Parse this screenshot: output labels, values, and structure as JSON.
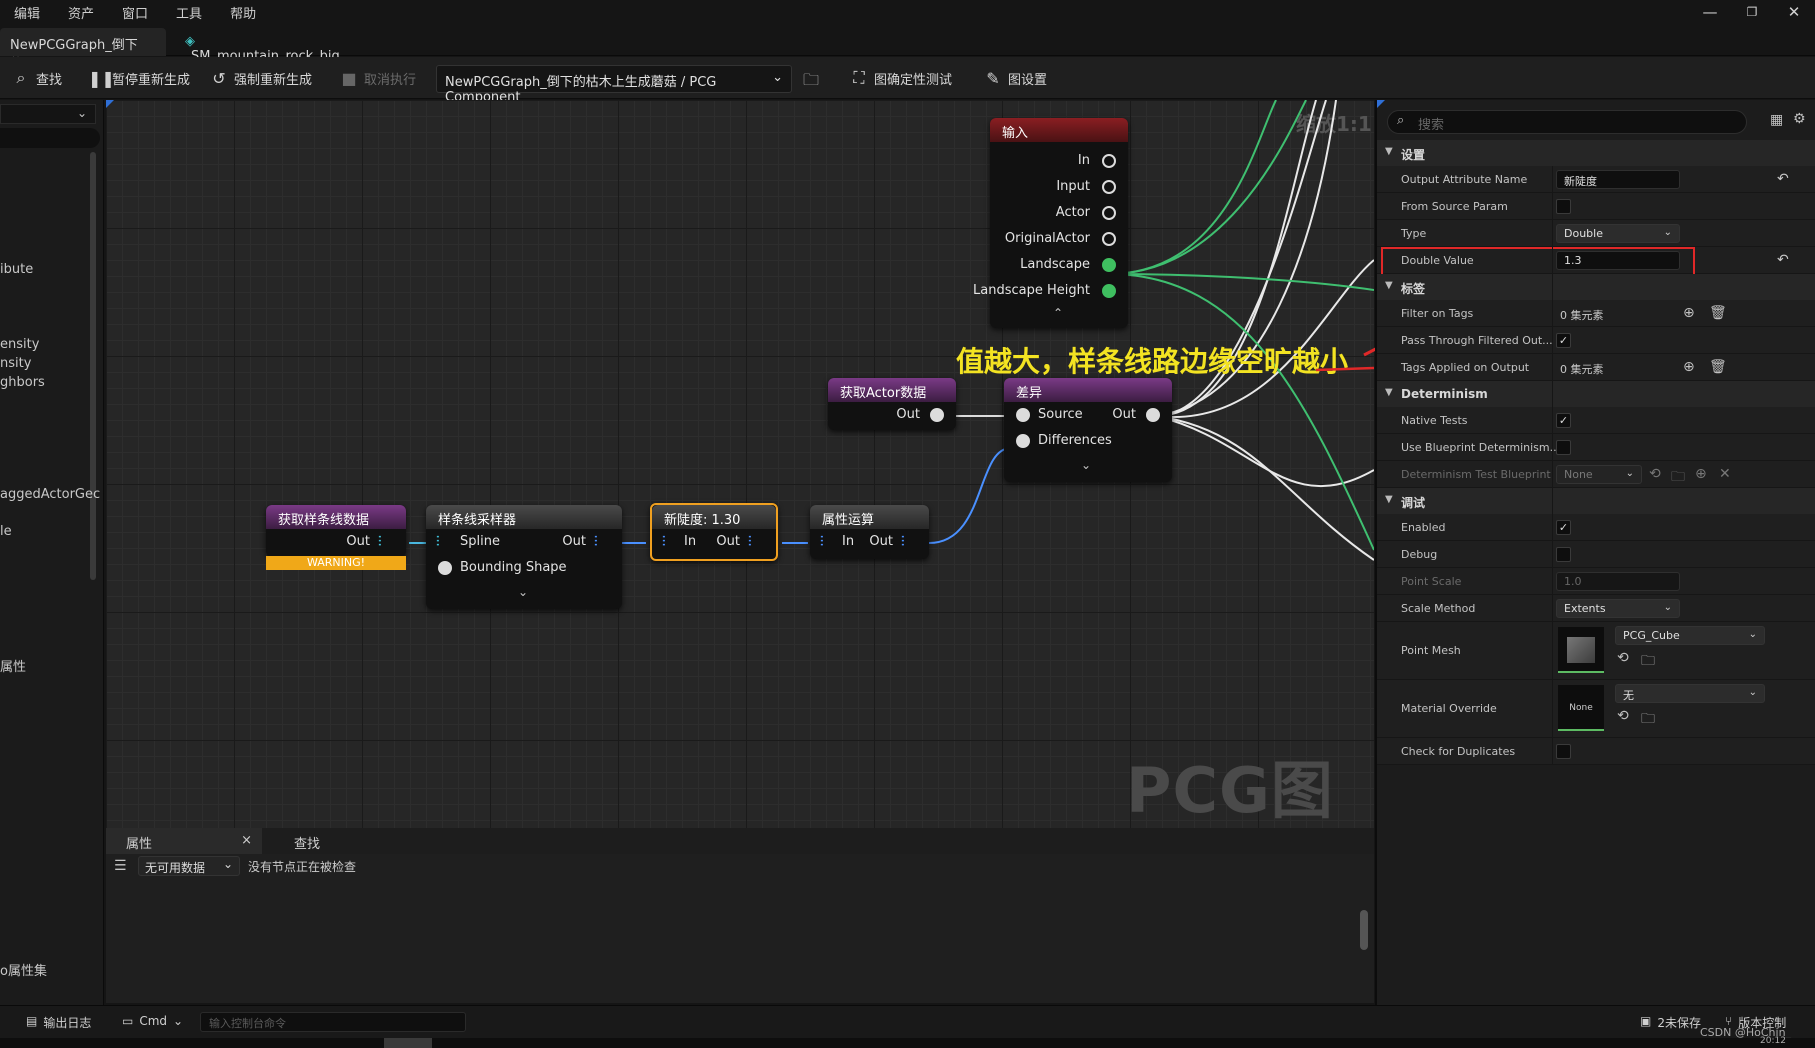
{
  "menu": {
    "items": [
      "编辑",
      "资产",
      "窗口",
      "工具",
      "帮助"
    ]
  },
  "window_controls": {
    "minimize": "—",
    "restore": "❐",
    "close": "✕"
  },
  "tabs": {
    "active": "NewPCGGraph_倒下的... • ×",
    "second": "SM_mountain_rock_big_..."
  },
  "toolbar": {
    "find": "查找",
    "pause_regen": "暂停重新生成",
    "force_regen": "强制重新生成",
    "cancel_exec": "取消执行",
    "debug_object": "NewPCGGraph_倒下的枯木上生成蘑菇 / PCG Component",
    "determinism_test": "图确定性测试",
    "graph_settings": "图设置"
  },
  "left_panel": {
    "items": [
      "ibute",
      "ensity",
      "nsity",
      "ghbors",
      "aggedActorGec",
      "le",
      "属性",
      "o属性集"
    ]
  },
  "graph": {
    "zoom": "缩放1:1",
    "watermark": "PCG图表",
    "annotation": "值越大，样条线路边缘空旷越小",
    "nodes": {
      "input": {
        "title": "输入",
        "pins": [
          "In",
          "Input",
          "Actor",
          "OriginalActor",
          "Landscape",
          "Landscape Height"
        ]
      },
      "get_actor": {
        "title": "获取Actor数据",
        "out": "Out"
      },
      "difference": {
        "title": "差异",
        "pins": [
          "Source",
          "Differences"
        ],
        "out": "Out"
      },
      "get_spline": {
        "title": "获取样条线数据",
        "out": "Out",
        "warning": "WARNING!"
      },
      "spline_sampler": {
        "title": "样条线采样器",
        "pins": [
          "Spline",
          "Bounding Shape"
        ],
        "out": "Out"
      },
      "density": {
        "title": "新陡度: 1.30",
        "in": "In",
        "out": "Out"
      },
      "attr_op": {
        "title": "属性运算",
        "in": "In",
        "out": "Out"
      }
    }
  },
  "bottom_panel": {
    "tab_properties": "属性",
    "tab_close": "×",
    "tab_find": "查找",
    "filter": "无可用数据",
    "message": "没有节点正在被检查"
  },
  "details": {
    "search_placeholder": "搜索",
    "sections": {
      "settings": "设置",
      "tags": "标签",
      "determinism": "Determinism",
      "debug": "调试"
    },
    "props": {
      "output_attr_name": {
        "label": "Output Attribute Name",
        "value": "新陡度"
      },
      "from_source_param": {
        "label": "From Source Param"
      },
      "type": {
        "label": "Type",
        "value": "Double"
      },
      "double_value": {
        "label": "Double Value",
        "value": "1.3"
      },
      "filter_on_tags": {
        "label": "Filter on Tags",
        "value": "0 集元素"
      },
      "pass_through": {
        "label": "Pass Through Filtered Out..."
      },
      "tags_applied": {
        "label": "Tags Applied on Output",
        "value": "0 集元素"
      },
      "native_tests": {
        "label": "Native Tests"
      },
      "use_bp_determinism": {
        "label": "Use Blueprint Determinism..."
      },
      "det_test_bp": {
        "label": "Determinism Test Blueprint",
        "value": "None"
      },
      "enabled": {
        "label": "Enabled"
      },
      "debug": {
        "label": "Debug"
      },
      "point_scale": {
        "label": "Point Scale",
        "value": "1.0"
      },
      "scale_method": {
        "label": "Scale Method",
        "value": "Extents"
      },
      "point_mesh": {
        "label": "Point Mesh",
        "value": "PCG_Cube"
      },
      "material_override": {
        "label": "Material Override",
        "value": "无",
        "thumb": "None"
      },
      "check_duplicates": {
        "label": "Check for Duplicates"
      }
    }
  },
  "statusbar": {
    "output_log": "输出日志",
    "cmd": "Cmd",
    "console_placeholder": "输入控制台命令",
    "unsaved": "2未保存",
    "source_control": "版本控制",
    "credit": "CSDN @HoChin_",
    "clock": "20:12"
  },
  "colors": {
    "input_header": "#8a1e22",
    "spatial_header": "#7a3a86",
    "meta_header": "#4a4a4a",
    "selected_border": "#f0a020",
    "warning": "#f0a818",
    "highlight_box": "#e02828",
    "annotation_text": "#f3e322"
  }
}
